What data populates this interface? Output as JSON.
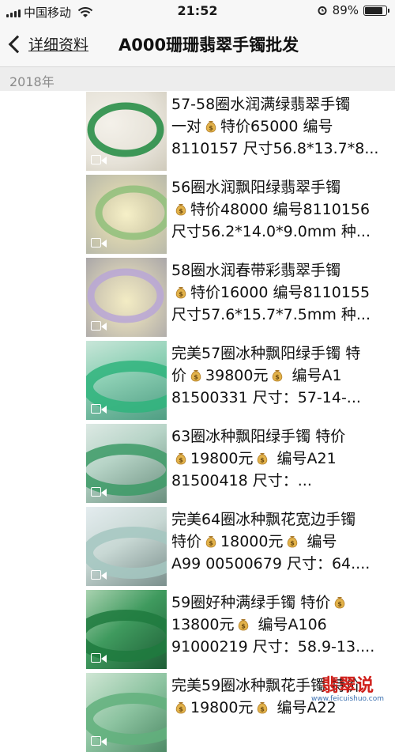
{
  "status_bar": {
    "carrier": "中国移动",
    "time": "21:52",
    "battery": "89%",
    "battery_level": 0.89
  },
  "nav": {
    "back_label": "详细资料",
    "title": "A000珊珊翡翠手镯批发"
  },
  "year_header": "2018年",
  "posts": [
    {
      "lines": [
        "57-58圈水润满绿翡翠手镯",
        "一对{money}特价65000 编号",
        "8110157 尺寸56.8*13.7*8..."
      ]
    },
    {
      "lines": [
        "56圈水润飘阳绿翡翠手镯",
        "{money}特价48000 编号8110156",
        "尺寸56.2*14.0*9.0mm 种..."
      ]
    },
    {
      "lines": [
        "58圈水润春带彩翡翠手镯",
        "{money}特价16000 编号8110155",
        "尺寸57.6*15.7*7.5mm 种..."
      ]
    },
    {
      "lines": [
        "完美57圈冰种飘阳绿手镯 特",
        "价{money}39800元{money} 编号A1",
        "81500331 尺寸：57-14-..."
      ]
    },
    {
      "lines": [
        "63圈冰种飘阳绿手镯 特价",
        "{money}19800元{money} 编号A21",
        "81500418 尺寸：..."
      ]
    },
    {
      "lines": [
        "完美64圈冰种飘花宽边手镯",
        "特价{money}18000元{money} 编号",
        "A99 00500679 尺寸：64...."
      ]
    },
    {
      "lines": [
        "59圈好种满绿手镯 特价{money}",
        "13800元{money} 编号A106",
        "91000219 尺寸：58.9-13...."
      ]
    },
    {
      "lines": [
        "完美59圈冰种飘花手镯 特价",
        "{money}19800元{money} 编号A22",
        ""
      ]
    }
  ],
  "watermark": {
    "logo": "翡翠说",
    "url": "www.feicuishuo.com"
  },
  "icons": {
    "money": "money-bag-icon",
    "video": "video-camera-icon",
    "back": "chevron-left-icon",
    "wifi": "wifi-icon",
    "alarm": "alarm-clock-icon"
  }
}
